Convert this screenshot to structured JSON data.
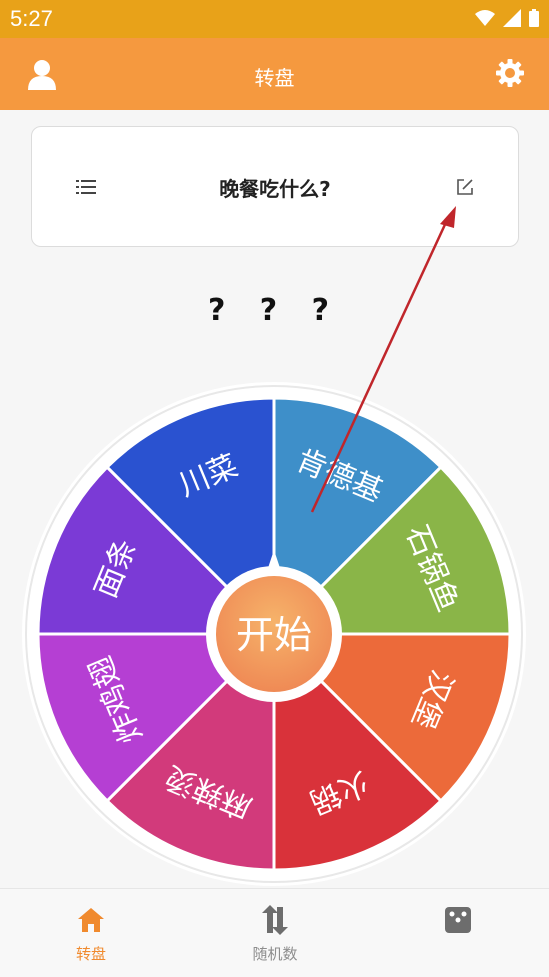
{
  "status": {
    "time": "5:27"
  },
  "appbar": {
    "title": "转盘"
  },
  "card": {
    "question": "晚餐吃什么?"
  },
  "result": "? ? ?",
  "wheel": {
    "start_label": "开始",
    "segments": [
      {
        "label": "肯德基",
        "color": "#3e8fc9"
      },
      {
        "label": "石锅鱼",
        "color": "#8ab548"
      },
      {
        "label": "汉堡",
        "color": "#ec6a3a"
      },
      {
        "label": "火锅",
        "color": "#d9323a"
      },
      {
        "label": "麻辣烫",
        "color": "#d23a7b"
      },
      {
        "label": "炸鸡翅",
        "color": "#b53fd3"
      },
      {
        "label": "面条",
        "color": "#7b3ad6"
      },
      {
        "label": "川菜",
        "color": "#2a52d0"
      }
    ]
  },
  "tabs": [
    {
      "label": "转盘",
      "icon": "home-icon",
      "active": true
    },
    {
      "label": "随机数",
      "icon": "swap-icon",
      "active": false
    },
    {
      "label": "",
      "icon": "dice-icon",
      "active": false
    }
  ],
  "colors": {
    "accent": "#f5993f",
    "statusbar": "#e8a219",
    "active_tab": "#f08a2e"
  }
}
